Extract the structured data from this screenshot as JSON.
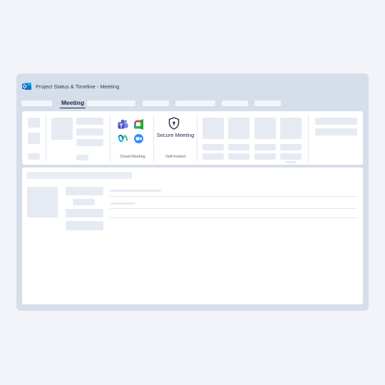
{
  "window": {
    "title": "Project Status & Timeline - Meeting"
  },
  "tabs": {
    "active_label": "Meeting"
  },
  "ribbon": {
    "cloud_meeting_label": "Cloud Meeting",
    "secure_meeting_label": "Secure Meeting",
    "self_hosted_label": "Self-hosted",
    "apps": [
      "teams-icon",
      "google-meet-icon",
      "webex-icon",
      "zoom-icon"
    ]
  },
  "colors": {
    "frame": "#d6deea",
    "background": "#f2f4f9",
    "placeholder": "#e6ebf3",
    "teams": "#5059c9",
    "meet": "#00ac47",
    "webex": "#00bceb",
    "zoom": "#2d8cff",
    "outlook": "#0f6cbd"
  }
}
